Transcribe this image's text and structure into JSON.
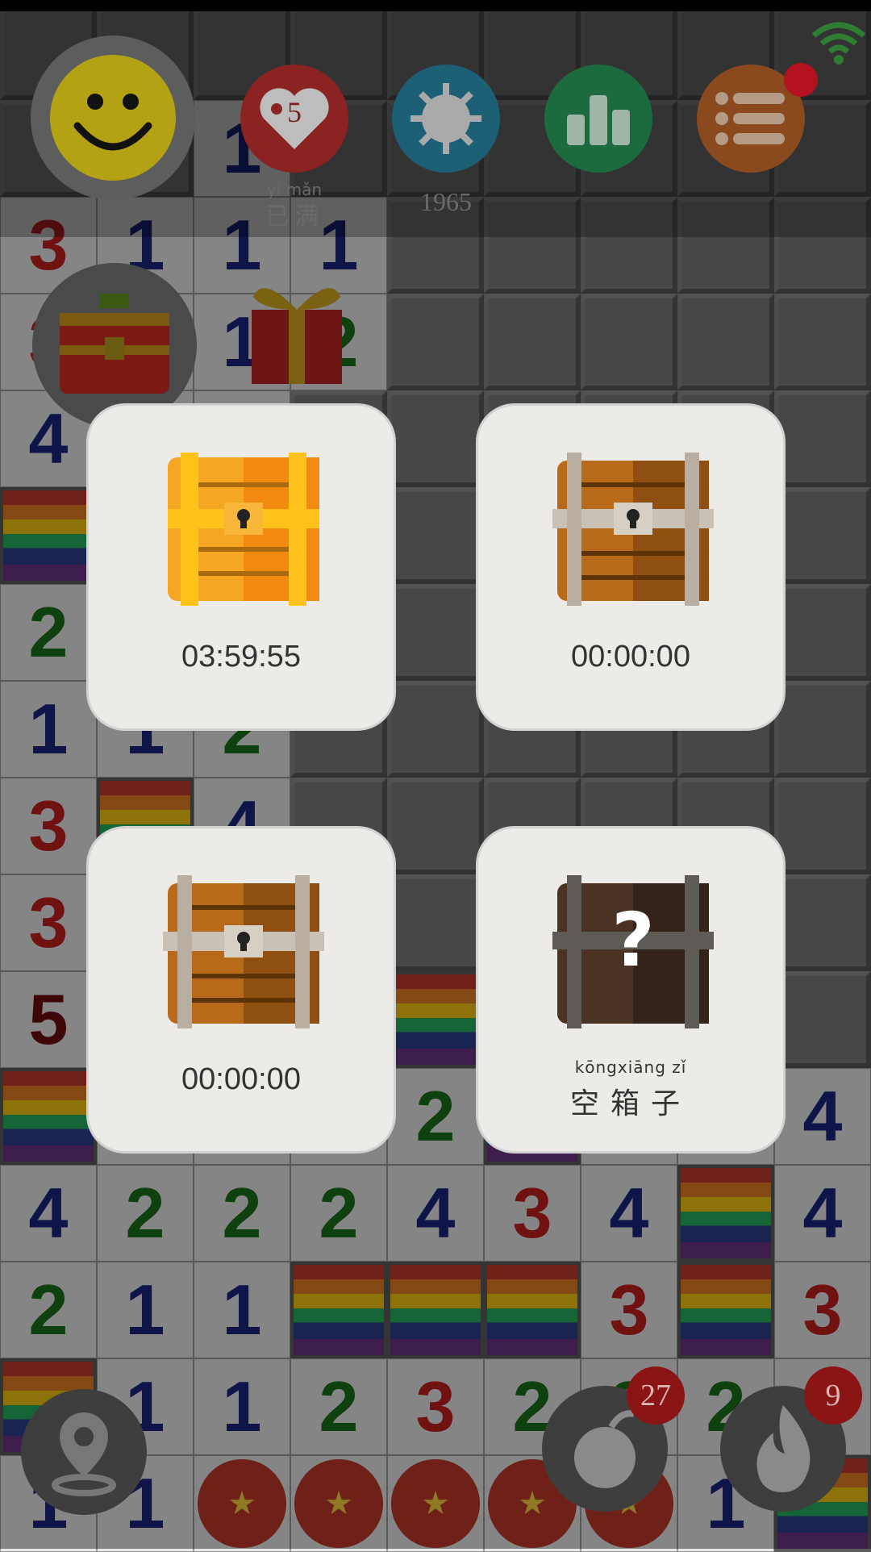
{
  "topbar": {
    "hearts": {
      "count": "5",
      "ruby": "yǐ mǎn",
      "label": "已满"
    },
    "virus": {
      "count": "1965"
    }
  },
  "chests": [
    {
      "type": "gold",
      "timer": "03:59:55"
    },
    {
      "type": "wood",
      "timer": "00:00:00"
    },
    {
      "type": "wood",
      "timer": "00:00:00"
    },
    {
      "type": "empty",
      "ruby": "kōngxiāng  zǐ",
      "label": "空箱子"
    }
  ],
  "bottom": {
    "bomb_count": "27",
    "fire_count": "9"
  },
  "board": {
    "rows": [
      [
        "c",
        "c",
        "c",
        "c",
        "c",
        "c",
        "c",
        "c",
        "c"
      ],
      [
        "c",
        "c",
        "1",
        "c",
        "c",
        "c",
        "c",
        "c",
        "c"
      ],
      [
        "3",
        "1",
        "1",
        "1",
        "c",
        "c",
        "c",
        "c",
        "c"
      ],
      [
        "3",
        "e",
        "1",
        "2",
        "c",
        "c",
        "c",
        "c",
        "c"
      ],
      [
        "4",
        "e",
        "e",
        "c",
        "c",
        "c",
        "c",
        "c",
        "c"
      ],
      [
        "F",
        "e",
        "e",
        "c",
        "c",
        "c",
        "c",
        "c",
        "c"
      ],
      [
        "2",
        "e",
        "e",
        "c",
        "c",
        "c",
        "c",
        "c",
        "c"
      ],
      [
        "1",
        "1",
        "2",
        "c",
        "c",
        "c",
        "c",
        "c",
        "c"
      ],
      [
        "3",
        "F",
        "4",
        "c",
        "c",
        "c",
        "c",
        "c",
        "c"
      ],
      [
        "3",
        "e",
        "e",
        "c",
        "c",
        "c",
        "c",
        "c",
        "c"
      ],
      [
        "5",
        "e",
        "e",
        "c",
        "F",
        "c",
        "c",
        "c",
        "c"
      ],
      [
        "F",
        "e",
        "e",
        "e",
        "2",
        "F",
        "e",
        "e",
        "4"
      ],
      [
        "4",
        "2",
        "2",
        "2",
        "4",
        "3",
        "4",
        "F",
        "4"
      ],
      [
        "2",
        "1",
        "1",
        "F",
        "F",
        "F",
        "3",
        "F",
        "3"
      ],
      [
        "F",
        "1",
        "1",
        "2",
        "3",
        "2",
        "2",
        "2",
        "2"
      ],
      [
        "1",
        "1",
        "o",
        "o",
        "o",
        "o",
        "o",
        "1",
        "F"
      ]
    ]
  }
}
